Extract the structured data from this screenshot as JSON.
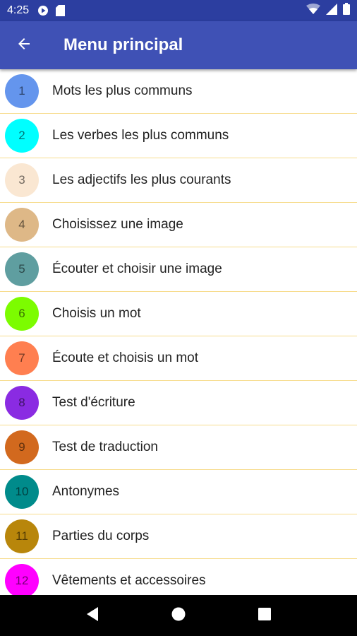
{
  "status_bar": {
    "time": "4:25"
  },
  "app_bar": {
    "title": "Menu principal"
  },
  "menu": {
    "items": [
      {
        "number": "1",
        "label": "Mots les plus communs",
        "color": "#6495ed"
      },
      {
        "number": "2",
        "label": "Les verbes les plus communs",
        "color": "#00ffff"
      },
      {
        "number": "3",
        "label": "Les adjectifs les plus courants",
        "color": "#fae7d2"
      },
      {
        "number": "4",
        "label": "Choisissez une image",
        "color": "#deb887"
      },
      {
        "number": "5",
        "label": "Écouter et choisir une image",
        "color": "#5f9ea0"
      },
      {
        "number": "6",
        "label": "Choisis un mot",
        "color": "#7cfc00"
      },
      {
        "number": "7",
        "label": "Écoute et choisis un mot",
        "color": "#ff7f50"
      },
      {
        "number": "8",
        "label": "Test d'écriture",
        "color": "#8a2be2"
      },
      {
        "number": "9",
        "label": "Test de traduction",
        "color": "#d2691e"
      },
      {
        "number": "10",
        "label": "Antonymes",
        "color": "#008b8b"
      },
      {
        "number": "11",
        "label": "Parties du corps",
        "color": "#b8860b"
      },
      {
        "number": "12",
        "label": "Vêtements et accessoires",
        "color": "#ff00ff"
      }
    ]
  },
  "icons": {
    "back": "arrow-back-icon",
    "nav_back": "triangle-back-icon",
    "nav_home": "circle-home-icon",
    "nav_recents": "square-recents-icon"
  }
}
